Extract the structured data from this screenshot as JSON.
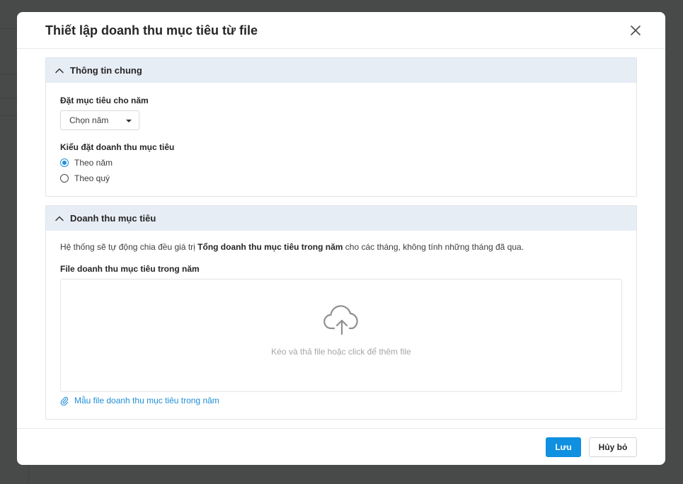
{
  "modal": {
    "title": "Thiết lập doanh thu mục tiêu từ file"
  },
  "general_section": {
    "title": "Thông tin chung",
    "year_label": "Đặt mục tiêu cho năm",
    "year_select_value": "Chọn năm",
    "type_label": "Kiểu đặt doanh thu mục tiêu",
    "options": [
      {
        "label": "Theo năm",
        "checked": true
      },
      {
        "label": "Theo quý",
        "checked": false
      }
    ]
  },
  "revenue_section": {
    "title": "Doanh thu mục tiêu",
    "desc_prefix": "Hệ thống sẽ tự động chia đều giá trị ",
    "desc_bold": "Tổng doanh thu mục tiêu trong năm",
    "desc_suffix": " cho các tháng, không tính những tháng đã qua.",
    "file_label": "File doanh thu mục tiêu trong năm",
    "drop_text": "Kéo và thả file hoặc click để thêm file",
    "template_link": "Mẫu file doanh thu mục tiêu trong năm"
  },
  "footer": {
    "save_label": "Lưu",
    "cancel_label": "Hủy bỏ"
  },
  "colors": {
    "accent": "#0f90e0",
    "section_header_bg": "#e7edf5",
    "link": "#1f8fd6"
  },
  "icons": {
    "close": "close-icon",
    "collapse": "chevron-up-icon",
    "upload": "cloud-upload-icon",
    "attachment": "paperclip-icon"
  }
}
